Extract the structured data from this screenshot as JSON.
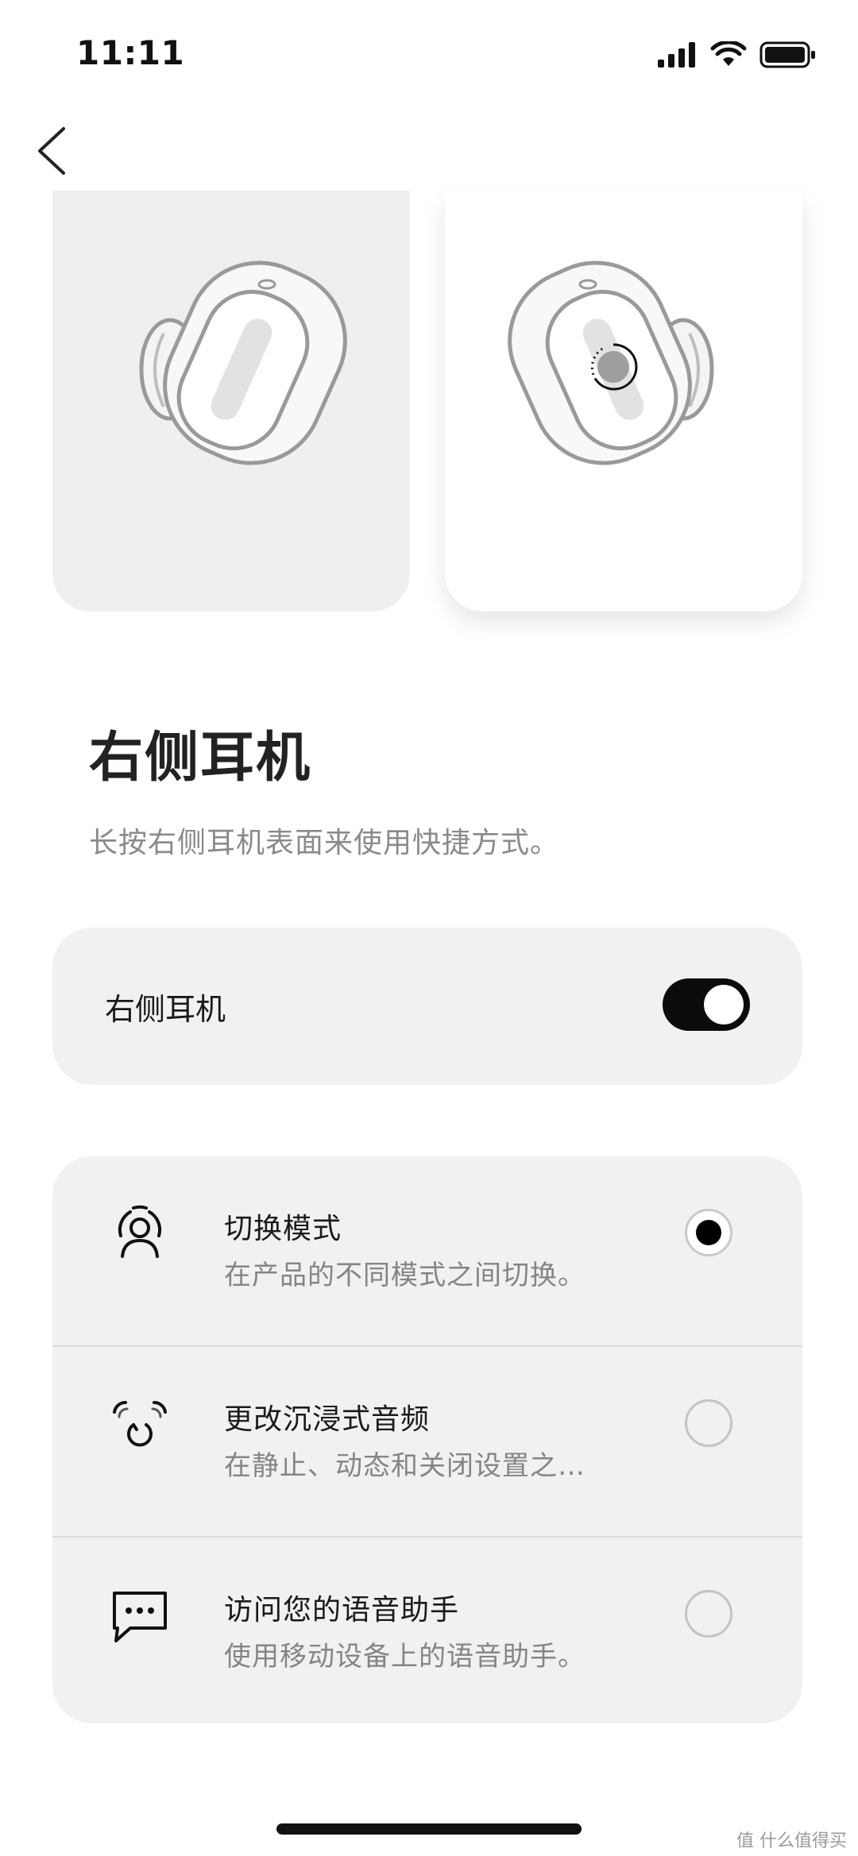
{
  "status_bar": {
    "time": "11:11",
    "icons": [
      "cellular-signal-icon",
      "wifi-icon",
      "battery-icon"
    ]
  },
  "nav": {
    "back_icon": "chevron-left-icon"
  },
  "illustrations": {
    "left": "left-earbud-illustration",
    "right": "right-earbud-touch-illustration",
    "selected": "right"
  },
  "title": "右侧耳机",
  "subtitle": "长按右侧耳机表面来使用快捷方式。",
  "toggle": {
    "label": "右侧耳机",
    "on": true
  },
  "options": [
    {
      "icon": "mode-switch-icon",
      "title": "切换模式",
      "desc": "在产品的不同模式之间切换。",
      "selected": true
    },
    {
      "icon": "immersive-audio-icon",
      "title": "更改沉浸式音频",
      "desc": "在静止、动态和关闭设置之…",
      "selected": false
    },
    {
      "icon": "voice-assistant-icon",
      "title": "访问您的语音助手",
      "desc": "使用移动设备上的语音助手。",
      "selected": false
    }
  ],
  "watermark": "值 什么值得买",
  "colors": {
    "accent": "#000000",
    "card_bg": "#f1f1f1",
    "muted_text": "#858585"
  }
}
